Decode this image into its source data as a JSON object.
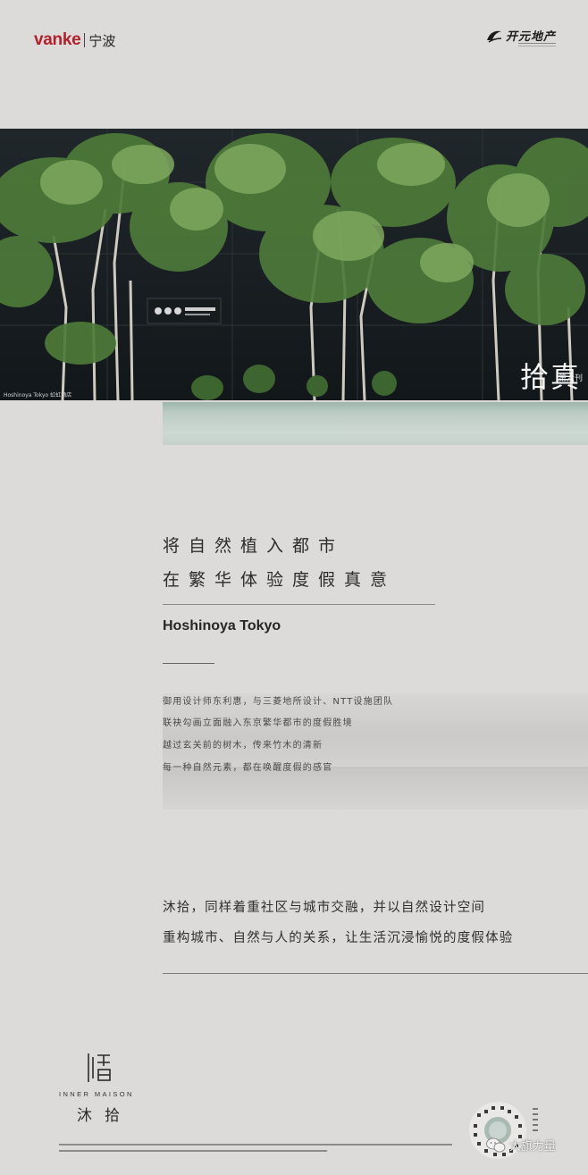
{
  "header": {
    "brand": "vanke",
    "city": "宁波",
    "partner_name": "开元地产"
  },
  "photo": {
    "caption": "Hoshinoya Tokyo 虹虹酒店",
    "tag": "第六刊",
    "glyph": "拾真"
  },
  "headline": {
    "line1": "将自然植入都市",
    "line2": "在繁华体验度假真意"
  },
  "subtitle": "Hoshinoya Tokyo",
  "description": [
    "御用设计师东利惠，与三菱地所设计、NTT设施团队",
    "联袂勾画立面融入东京繁华都市的度假胜境",
    "越过玄关前的树木，传来竹木的清新",
    "每一种自然元素，都在唤醒度假的感官"
  ],
  "paragraph": {
    "line1": "沐拾，同样着重社区与城市交融，并以自然设计空间",
    "line2": "重构城市、自然与人的关系，让生活沉浸愉悦的度假体验"
  },
  "footer": {
    "logo_en": "INNER MAISON",
    "logo_cn": "沐拾",
    "watermark": "大旗力量"
  },
  "colors": {
    "brand_red": "#b3202b",
    "background": "#dcdbd9",
    "teal": "#bcccc4"
  }
}
